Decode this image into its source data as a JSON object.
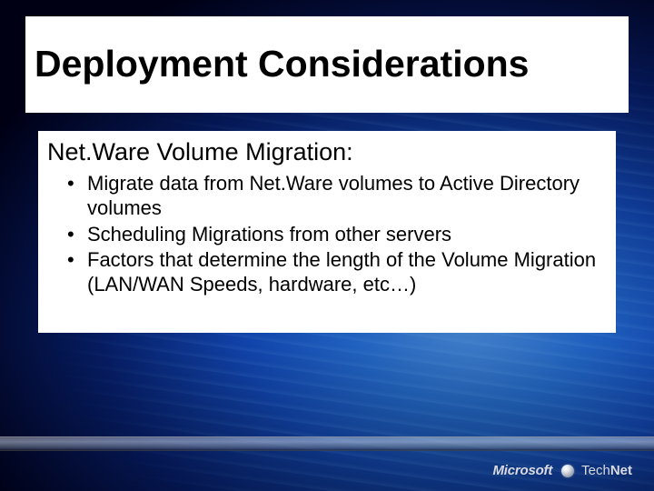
{
  "title": "Deployment Considerations",
  "subheading": "Net.Ware Volume Migration:",
  "bullets": [
    "Migrate data from Net.Ware volumes to Active Directory volumes",
    "Scheduling Migrations from other servers",
    "Factors that determine the length of the Volume Migration (LAN/WAN Speeds, hardware, etc…)"
  ],
  "logo": {
    "brand": "Microsoft",
    "product_prefix": "Tech",
    "product_suffix": "Net"
  }
}
